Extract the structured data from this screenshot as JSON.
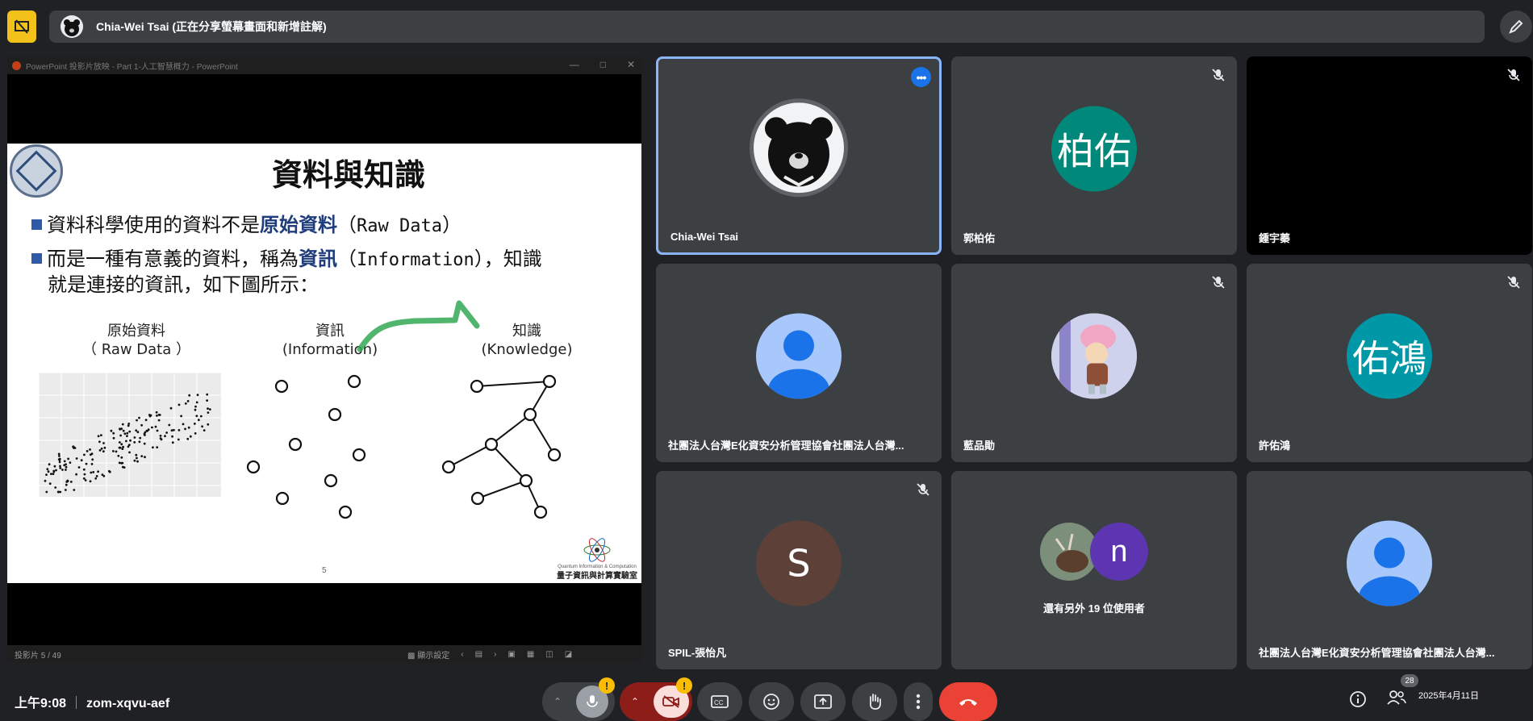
{
  "presenter_bar": {
    "name": "Chia-Wei Tsai (正在分享螢幕畫面和新增註解)"
  },
  "powerpoint": {
    "window_title": "PowerPoint 投影片放映 - Part 1-人工智慧概力 - PowerPoint",
    "status_slide": "投影片 5 / 49",
    "status_display": "顯示設定"
  },
  "slide": {
    "title": "資料與知識",
    "bullet1": {
      "a": "資料科學使用的資料不是",
      "hl": "原始資料",
      "open": "（",
      "mono": "Raw Data",
      "close": "）"
    },
    "bullet2": {
      "a": "而是一種有意義的資料，稱為",
      "hl": "資訊",
      "open": "（",
      "mono": "Information",
      "close": "），知識",
      "line2": "就是連接的資訊，如下圖所示："
    },
    "col1": {
      "l1": "原始資料",
      "l2": "（ Raw Data ）"
    },
    "col2": {
      "l1": "資訊",
      "l2": "(Information)"
    },
    "col3": {
      "l1": "知識",
      "l2": "(Knowledge)"
    },
    "page_number": "5",
    "lab_small": "Quantum Information & Computation",
    "lab_name": "量子資訊與計算實驗室"
  },
  "tiles": [
    {
      "label": "Chia-Wei Tsai",
      "avatar": "bear-photo",
      "pinned": true
    },
    {
      "label": "郭柏佑",
      "avatar_text": "柏佑",
      "color": "#00897b",
      "muted": true
    },
    {
      "label": "鍾宇蓁",
      "video_off_black": true,
      "muted": true
    },
    {
      "label": "社團法人台灣E化資安分析管理協會社團法人台灣...",
      "avatar": "default-person",
      "color": "#a8c7fa"
    },
    {
      "label": "藍品勛",
      "avatar": "anime-photo",
      "muted": true
    },
    {
      "label": "許佑鴻",
      "avatar_text": "佑鴻",
      "color": "#0097a7",
      "muted": true
    },
    {
      "label": "SPIL-張怡凡",
      "avatar_text": "S",
      "color": "#5d4037",
      "muted": true
    },
    {
      "label": "還有另外 19 位使用者",
      "group_initial": "n",
      "group_color": "#5e35b1"
    },
    {
      "label": "社團法人台灣E化資安分析管理協會社團法人台灣...",
      "avatar": "default-person",
      "color": "#a8c7fa"
    }
  ],
  "bottom": {
    "time": "上午9:08",
    "meeting_code": "zom-xqvu-aef",
    "participants_count": "28",
    "date": "2025年4月11日",
    "mic_warning": "!",
    "cam_warning": "!"
  },
  "colors": {
    "background": "#202124",
    "tile": "#3c4043",
    "accent": "#8ab4f8",
    "leave": "#ea4335",
    "presenting": "#f2c21b"
  }
}
